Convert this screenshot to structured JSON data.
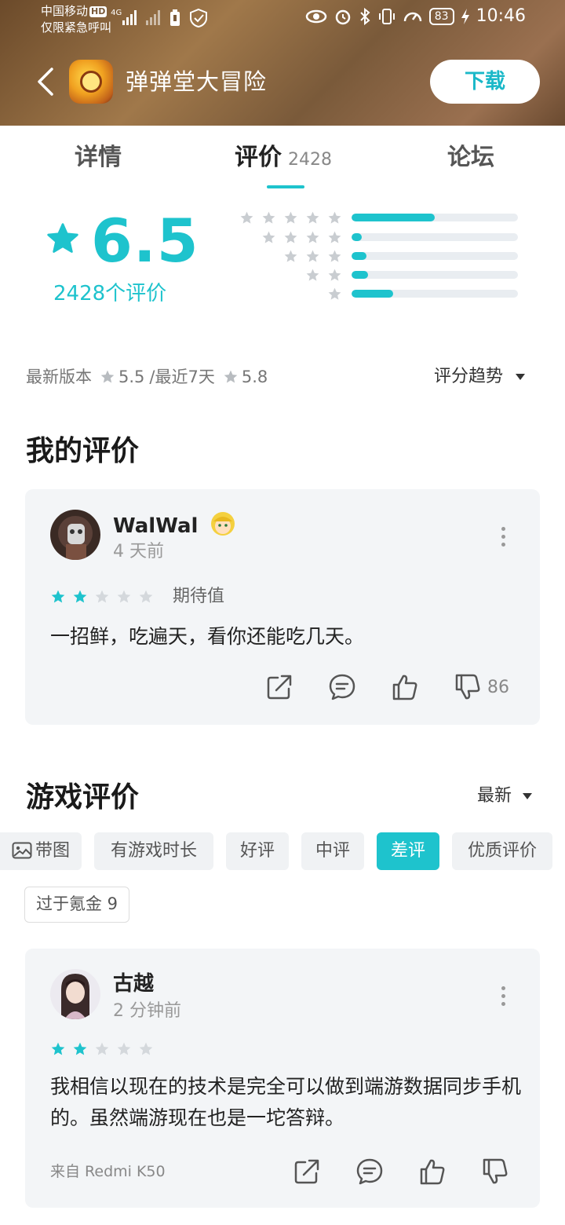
{
  "status_bar": {
    "carrier": "中国移动",
    "hd_badge": "HD",
    "network": "4G",
    "emergency": "仅限紧急呼叫",
    "battery": "83",
    "time": "10:46"
  },
  "header": {
    "app_name": "弹弹堂大冒险",
    "download_label": "下载"
  },
  "tabs": [
    {
      "label": "详情"
    },
    {
      "label": "评价",
      "count": "2428",
      "active": true
    },
    {
      "label": "论坛"
    }
  ],
  "rating": {
    "score": "6.5",
    "count_label": "2428个评价",
    "distribution": [
      {
        "stars": 5,
        "fraction": 0.5
      },
      {
        "stars": 4,
        "fraction": 0.06
      },
      {
        "stars": 3,
        "fraction": 0.09
      },
      {
        "stars": 2,
        "fraction": 0.1
      },
      {
        "stars": 1,
        "fraction": 0.25
      }
    ],
    "latest_version_label": "最新版本",
    "latest_version_score": "5.5",
    "recent_label": "/最近7天",
    "recent_score": "5.8",
    "trend_label": "评分趋势"
  },
  "my_review": {
    "section_title": "我的评价",
    "user": "WalWal",
    "time": "4 天前",
    "stars": 2,
    "rating_label": "期待值",
    "text": "一招鲜，吃遍天，看你还能吃几天。",
    "dislike_count": "86"
  },
  "game_reviews": {
    "section_title": "游戏评价",
    "sort_label": "最新",
    "filters": [
      {
        "label": "带图"
      },
      {
        "label": "有游戏时长"
      },
      {
        "label": "好评"
      },
      {
        "label": "中评"
      },
      {
        "label": "差评",
        "active": true
      },
      {
        "label": "优质评价"
      }
    ],
    "tag": "过于氪金 9",
    "items": [
      {
        "user": "古越",
        "time": "2 分钟前",
        "stars": 2,
        "text": "我相信以现在的技术是完全可以做到端游数据同步手机的。虽然端游现在也是一坨答辩。",
        "device": "来自 Redmi K50"
      }
    ]
  },
  "colors": {
    "accent": "#1ec3cd",
    "star_empty": "#d4d8dc",
    "card_bg": "#f3f5f7"
  }
}
